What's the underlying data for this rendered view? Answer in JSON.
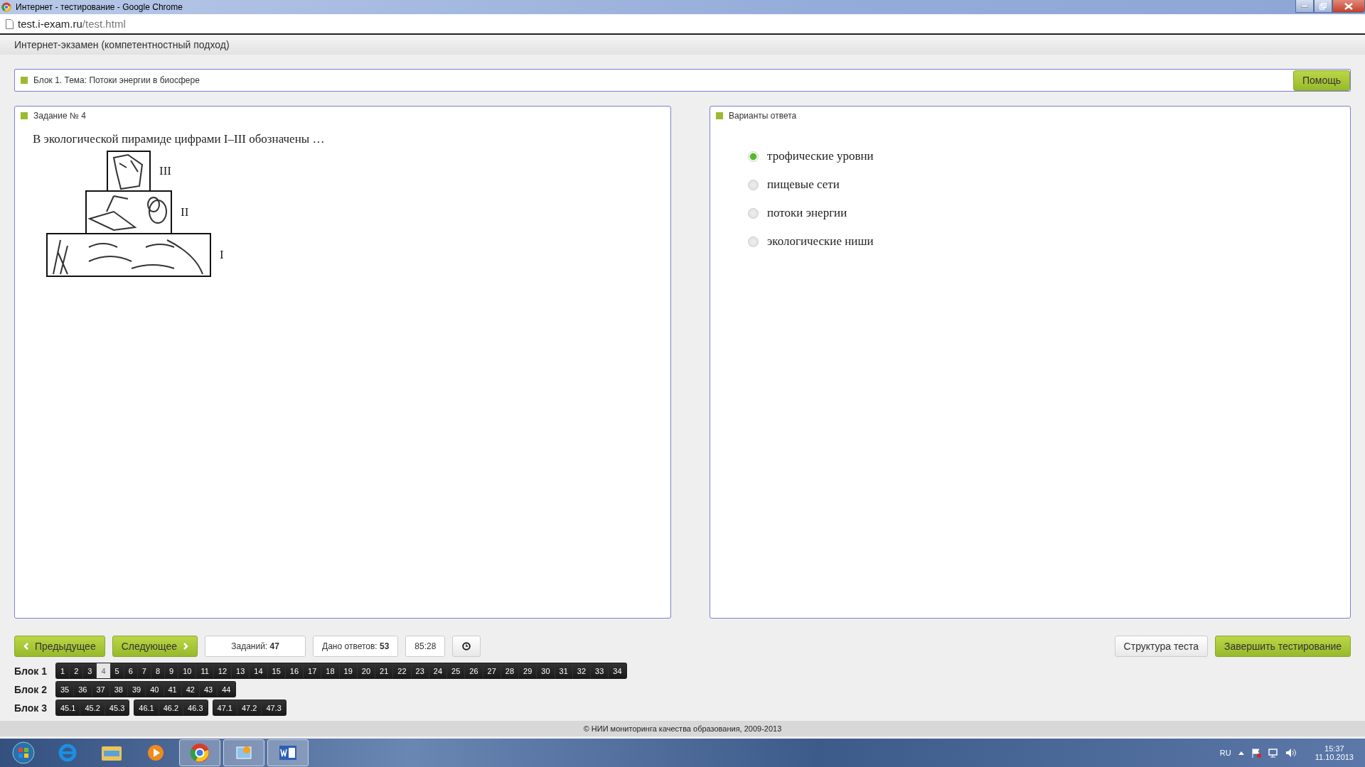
{
  "window": {
    "title": "Интернет - тестирование - Google Chrome"
  },
  "address_bar": {
    "host": "test.i-exam.ru",
    "path": "/test.html"
  },
  "app_header": {
    "title": "Интернет-экзамен (компетентностный подход)"
  },
  "block_bar": {
    "title": "Блок 1. Тема: Потоки энергии в биосфере",
    "help_button": "Помощь"
  },
  "task_panel": {
    "title": "Задание № 4",
    "question": "В экологической пирамиде цифрами I–III обозначены …",
    "pyramid_labels": [
      "III",
      "II",
      "I"
    ]
  },
  "answers_panel": {
    "title": "Варианты ответа",
    "options": [
      {
        "text": "трофические уровни",
        "selected": true
      },
      {
        "text": "пищевые сети",
        "selected": false
      },
      {
        "text": "потоки энергии",
        "selected": false
      },
      {
        "text": "экологические ниши",
        "selected": false
      }
    ]
  },
  "toolbar": {
    "prev": "Предыдущее",
    "next": "Следующее",
    "tasks_count": "Заданий: **47**",
    "answers_count": "Дано ответов: **53**",
    "timer": "85:28",
    "structure": "Структура теста",
    "finish": "Завершить тестирование"
  },
  "blocks": [
    {
      "label": "Блок 1",
      "groups": [
        [
          {
            "n": "1",
            "selected": false
          },
          {
            "n": "2",
            "selected": false
          },
          {
            "n": "3",
            "selected": false
          },
          {
            "n": "4",
            "selected": true
          },
          {
            "n": "5",
            "selected": false
          },
          {
            "n": "6",
            "selected": false
          },
          {
            "n": "7",
            "selected": false
          },
          {
            "n": "8",
            "selected": false
          },
          {
            "n": "9",
            "selected": false
          },
          {
            "n": "10",
            "selected": false
          },
          {
            "n": "11",
            "selected": false
          },
          {
            "n": "12",
            "selected": false
          },
          {
            "n": "13",
            "selected": false
          },
          {
            "n": "14",
            "selected": false
          },
          {
            "n": "15",
            "selected": false
          },
          {
            "n": "16",
            "selected": false
          },
          {
            "n": "17",
            "selected": false
          },
          {
            "n": "18",
            "selected": false
          },
          {
            "n": "19",
            "selected": false
          },
          {
            "n": "20",
            "selected": false
          },
          {
            "n": "21",
            "selected": false
          },
          {
            "n": "22",
            "selected": false
          },
          {
            "n": "23",
            "selected": false
          },
          {
            "n": "24",
            "selected": false
          },
          {
            "n": "25",
            "selected": false
          },
          {
            "n": "26",
            "selected": false
          },
          {
            "n": "27",
            "selected": false
          },
          {
            "n": "28",
            "selected": false
          },
          {
            "n": "29",
            "selected": false
          },
          {
            "n": "30",
            "selected": false
          },
          {
            "n": "31",
            "selected": false
          },
          {
            "n": "32",
            "selected": false
          },
          {
            "n": "33",
            "selected": false
          },
          {
            "n": "34",
            "selected": false
          }
        ]
      ]
    },
    {
      "label": "Блок 2",
      "groups": [
        [
          {
            "n": "35",
            "selected": false
          },
          {
            "n": "36",
            "selected": false
          },
          {
            "n": "37",
            "selected": false
          },
          {
            "n": "38",
            "selected": false
          },
          {
            "n": "39",
            "selected": false
          },
          {
            "n": "40",
            "selected": false
          },
          {
            "n": "41",
            "selected": false
          },
          {
            "n": "42",
            "selected": false
          },
          {
            "n": "43",
            "selected": false
          },
          {
            "n": "44",
            "selected": false
          }
        ]
      ]
    },
    {
      "label": "Блок 3",
      "groups": [
        [
          {
            "n": "45.1",
            "selected": false
          },
          {
            "n": "45.2",
            "selected": false
          },
          {
            "n": "45.3",
            "selected": false
          }
        ],
        [
          {
            "n": "46.1",
            "selected": false
          },
          {
            "n": "46.2",
            "selected": false
          },
          {
            "n": "46.3",
            "selected": false
          }
        ],
        [
          {
            "n": "47.1",
            "selected": false
          },
          {
            "n": "47.2",
            "selected": false
          },
          {
            "n": "47.3",
            "selected": false
          }
        ]
      ]
    }
  ],
  "footer": {
    "text": "© НИИ мониторинга качества образования, 2009-2013"
  },
  "taskbar": {
    "language": "RU",
    "time": "15:37",
    "date": "11.10.2013"
  }
}
